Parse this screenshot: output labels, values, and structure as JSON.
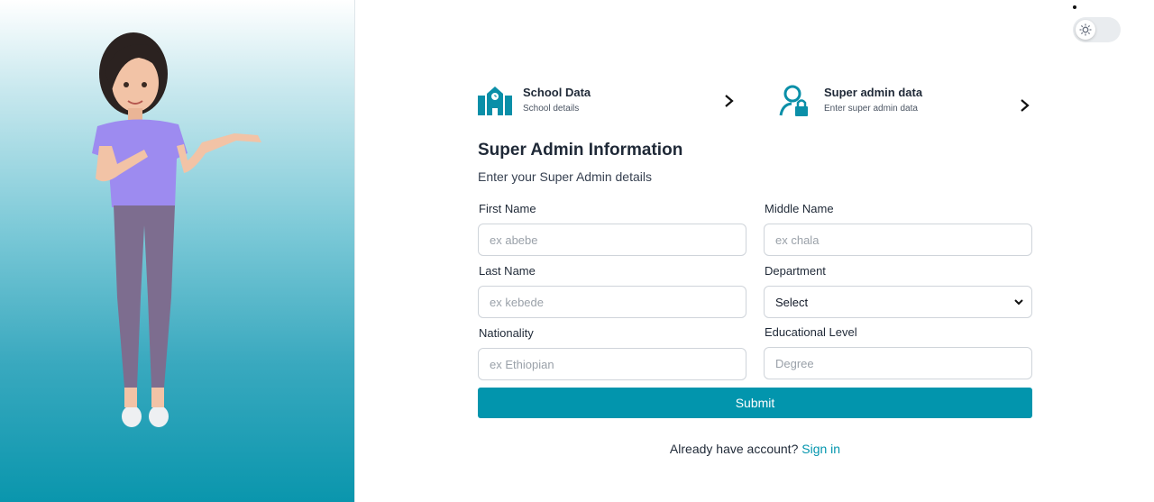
{
  "theme": {
    "toggle_icon": "sun-icon",
    "mode": "light"
  },
  "steps": [
    {
      "title": "School Data",
      "subtitle": "School details",
      "icon": "school-building-icon"
    },
    {
      "title": "Super admin data",
      "subtitle": "Enter super admin data",
      "icon": "user-lock-icon"
    }
  ],
  "form": {
    "title": "Super Admin Information",
    "subtitle": "Enter your Super Admin details",
    "first_name": {
      "label": "First Name",
      "placeholder": "ex abebe"
    },
    "middle_name": {
      "label": "Middle Name",
      "placeholder": "ex chala"
    },
    "last_name": {
      "label": "Last Name",
      "placeholder": "ex kebede"
    },
    "department": {
      "label": "Department",
      "selected": "Select"
    },
    "nationality": {
      "label": "Nationality",
      "placeholder": "ex Ethiopian"
    },
    "educational_level": {
      "label": "Educational Level",
      "placeholder": "Degree"
    },
    "submit_label": "Submit"
  },
  "footer": {
    "prompt": "Already have account?",
    "link": "Sign in"
  },
  "colors": {
    "accent": "#0295ad",
    "text": "#1f2937",
    "panel_bottom": "#0a96ad"
  }
}
